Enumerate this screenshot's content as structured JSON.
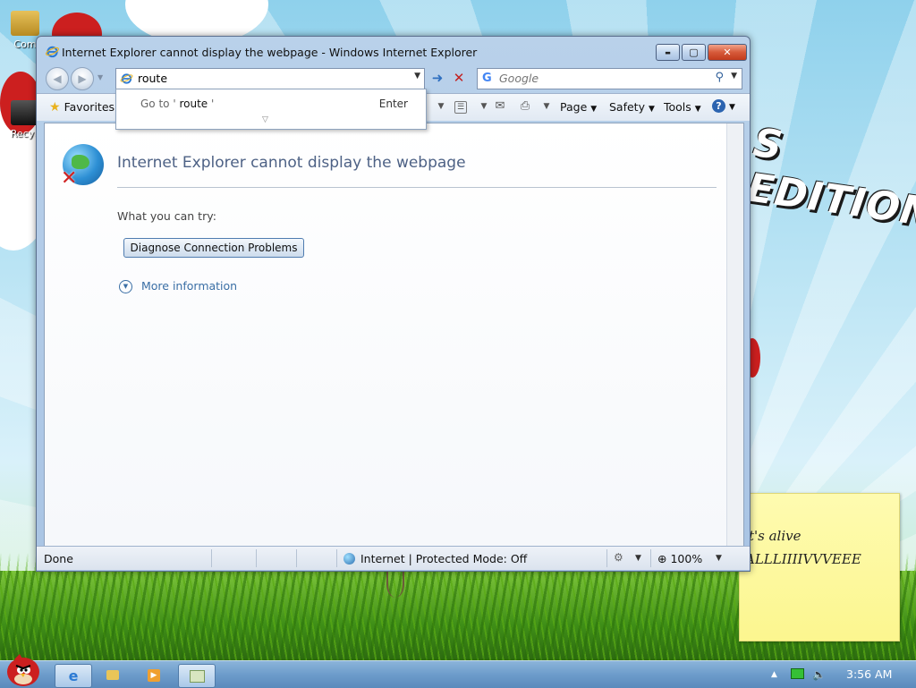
{
  "desktop": {
    "icons": [
      {
        "label": "Com"
      },
      {
        "label": "Recyc"
      }
    ],
    "wallpaper_text": "S EDITION"
  },
  "sticky_note": {
    "lines": [
      "t's alive",
      "ALLLIIIIVVVEEE"
    ]
  },
  "window": {
    "title": "Internet Explorer cannot display the webpage - Windows Internet Explorer",
    "controls": {
      "minimize": "▬",
      "maximize": "▢",
      "close": "✕"
    },
    "address": {
      "value": "route"
    },
    "search": {
      "engine_glyph": "G",
      "placeholder": "Google"
    },
    "command_bar": {
      "favorites": "Favorites",
      "page": "Page",
      "safety": "Safety",
      "tools": "Tools",
      "help_glyph": "?"
    },
    "autocomplete": {
      "prefix": "Go to '",
      "term": "route",
      "suffix": "'",
      "enter": "Enter"
    },
    "error_page": {
      "title": "Internet Explorer cannot display the webpage",
      "what_you_can_try": "What you can try:",
      "diagnose_button": "Diagnose Connection Problems",
      "more_information": "More information"
    },
    "status_bar": {
      "status": "Done",
      "zone": "Internet | Protected Mode: Off",
      "zoom": "100%"
    }
  },
  "taskbar": {
    "clock": "3:56 AM",
    "items": [
      {
        "icon": "internet-explorer-icon",
        "active": true
      },
      {
        "icon": "folder-icon",
        "active": false
      },
      {
        "icon": "media-player-icon",
        "active": false
      },
      {
        "icon": "switch-windows-icon",
        "active": true
      }
    ]
  },
  "colors": {
    "link_blue": "#3a6ea5",
    "error_title": "#4d6185",
    "taskbar": "#6d9ccb",
    "sticky": "#fcf68f"
  }
}
